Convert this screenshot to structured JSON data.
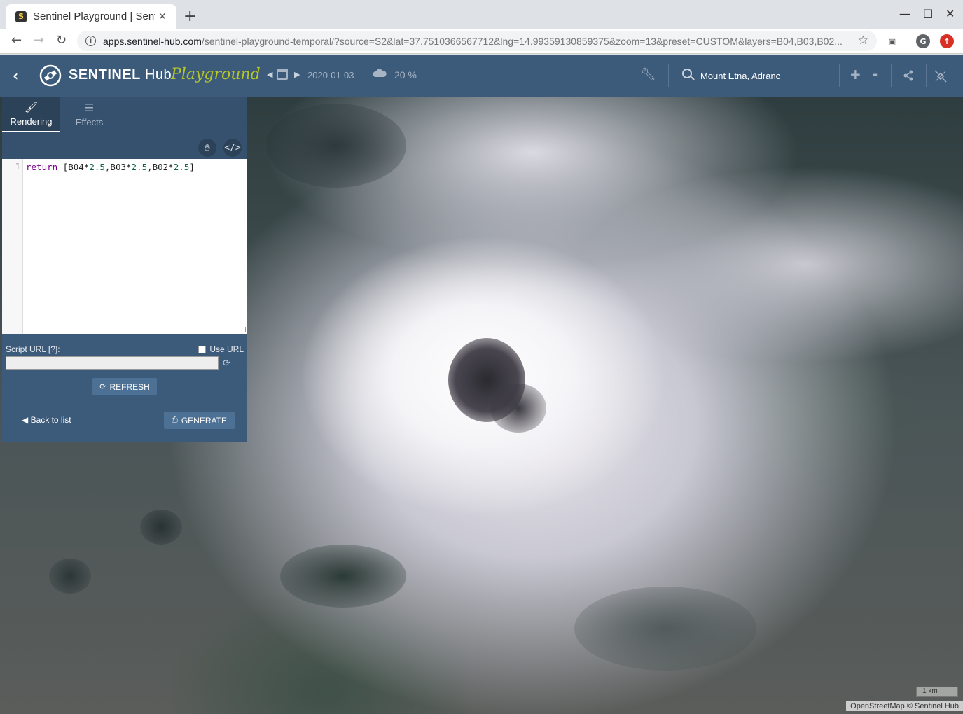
{
  "browser": {
    "tab_title": "Sentinel Playground | Sentinel Hub",
    "tab_favicon": "S",
    "new_tab": "+",
    "window_controls": [
      "—",
      "☐",
      "✕"
    ],
    "url_host": "apps.sentinel-hub.com",
    "url_rest": "/sentinel-playground-temporal/?source=S2&lat=37.7510366567712&lng=14.99359130859375&zoom=13&preset=CUSTOM&layers=B04,B03,B02...",
    "profile_initial": "G"
  },
  "app": {
    "back": "‹",
    "brand_bold": "SENTINEL",
    "brand_light": " Hub",
    "brand_script": "Playground",
    "date": "2020-01-03",
    "cloud_coverage": "20 %",
    "search_value": "Mount Etna, Adranc",
    "zoom_in": "+",
    "zoom_out": "-"
  },
  "panel": {
    "tabs": [
      {
        "label": "Rendering",
        "icon": "paintbrush-icon",
        "active": true
      },
      {
        "label": "Effects",
        "icon": "sliders-icon",
        "active": false
      }
    ],
    "editor": {
      "line_number": "1",
      "code_keyword": "return",
      "code_parts": [
        " [B04*",
        "2.5",
        ",B03*",
        "2.5",
        ",B02*",
        "2.5",
        "]"
      ]
    },
    "script_url_label": "Script URL [?]:",
    "use_url_label": "Use URL",
    "refresh_label": "REFRESH",
    "back_to_list_label": "Back to list",
    "generate_label": "GENERATE"
  },
  "map": {
    "scale_label": "1 km",
    "attribution": "OpenStreetMap  © Sentinel Hub"
  },
  "colors": {
    "header": "#3c5a7a",
    "panel": "#3c5a7a",
    "accent_script": "#b5c62a",
    "button": "#4d7194"
  }
}
